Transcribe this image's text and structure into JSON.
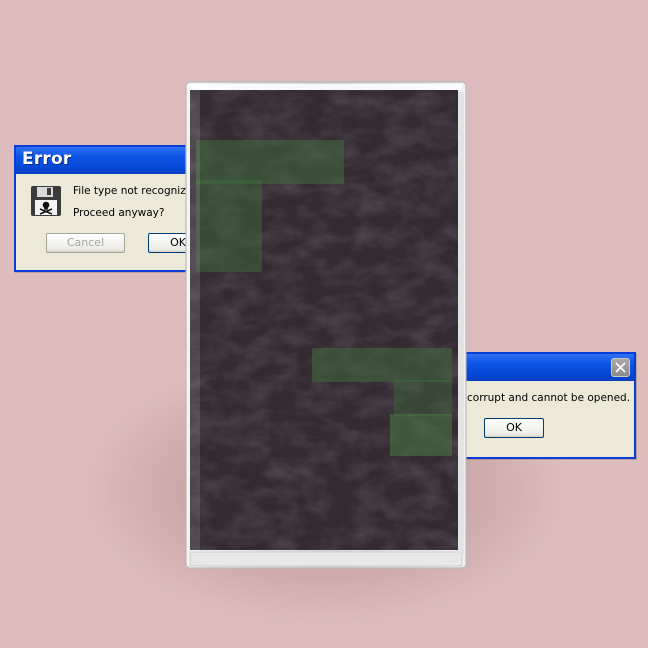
{
  "dialog_left": {
    "title": "Error",
    "message_line1": "File type not recognized.",
    "message_line2": "Proceed anyway?",
    "cancel_label": "Cancel",
    "ok_label": "OK",
    "icon": "floppy-disk-skull-icon"
  },
  "dialog_right": {
    "message": "corrupt and cannot be opened.",
    "ok_label": "OK",
    "icon": "close-icon"
  },
  "cassette": {
    "cover": "dark purple textured cover with green blocks"
  },
  "colors": {
    "background": "#dcbcbc",
    "titlebar": "#0a4fdd",
    "dialog_body": "#ece9d8",
    "cover": "#3a3038",
    "accent_green": "#3f6b3c"
  }
}
